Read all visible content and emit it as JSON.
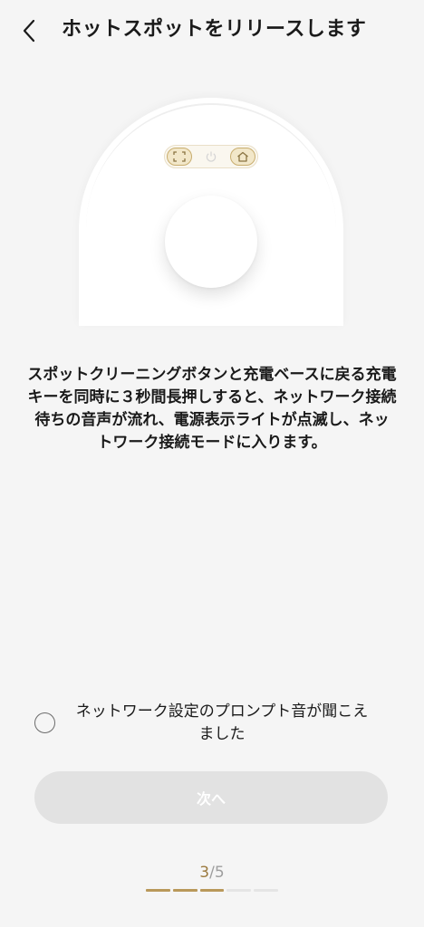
{
  "header": {
    "title": "ホットスポットをリリースします",
    "back_icon": "chevron-left-icon"
  },
  "illustration": {
    "keys": [
      "spot-clean-key",
      "power-key",
      "home-charge-key"
    ],
    "highlighted_keys": [
      "spot-clean-key",
      "home-charge-key"
    ],
    "accent_color": "#c8ad6e"
  },
  "instruction": {
    "text": "スポットクリーニングボタンと充電ベースに戻る充電キーを同時に３秒間長押しすると、ネットワーク接続待ちの音声が流れ、電源表示ライトが点滅し、ネットワーク接続モードに入ります。"
  },
  "confirm": {
    "checked": false,
    "label": "ネットワーク設定のプロンプト音が聞こえました"
  },
  "next_button": {
    "label": "次へ",
    "enabled": false
  },
  "pager": {
    "current": "3",
    "separator": "/",
    "total": "5",
    "steps_total": 5,
    "steps_done": 3,
    "accent_color": "#b9985a"
  }
}
